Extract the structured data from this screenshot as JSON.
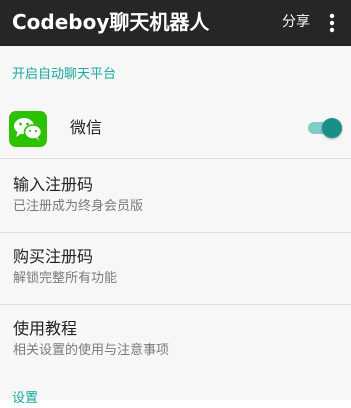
{
  "app_bar": {
    "title": "Codeboy聊天机器人",
    "share_label": "分享",
    "more_icon": "more-vert-icon",
    "background": "#262626"
  },
  "sections": {
    "auto_chat_header": "开启自动聊天平台",
    "settings_header": "设置",
    "accent": "#18a8a0"
  },
  "wechat": {
    "icon": "wechat-icon",
    "label": "微信",
    "enabled": true,
    "brand_color": "#2dc100"
  },
  "items": [
    {
      "title": "输入注册码",
      "summary": "已注册成为终身会员版"
    },
    {
      "title": "购买注册码",
      "summary": "解锁完整所有功能"
    },
    {
      "title": "使用教程",
      "summary": "相关设置的使用与注意事项"
    }
  ]
}
